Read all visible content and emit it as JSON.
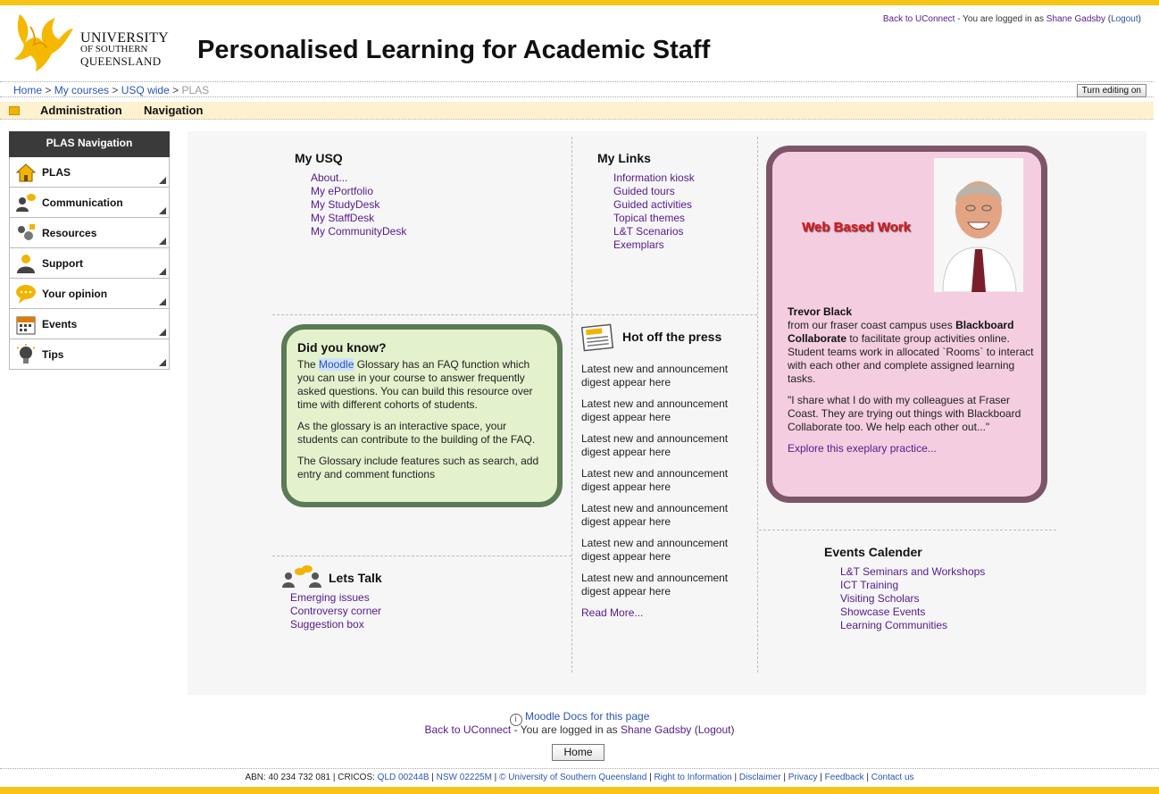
{
  "header": {
    "logo": {
      "line1": "UNIVERSITY",
      "line2": "OF SOUTHERN",
      "line3": "QUEENSLAND"
    },
    "title": "Personalised Learning for Academic Staff",
    "login": {
      "back": "Back to UConnect",
      "mid": " - You are logged in as ",
      "user": "Shane Gadsby",
      "open": " (",
      "logout": "Logout",
      "close": ")"
    }
  },
  "breadcrumb": {
    "home": "Home",
    "sep": " > ",
    "courses": "My courses",
    "usq": "USQ wide",
    "current": "PLAS"
  },
  "edit_button": "Turn editing on",
  "menubar": {
    "admin": "Administration",
    "nav": "Navigation"
  },
  "sidenav": {
    "title": "PLAS Navigation",
    "items": [
      {
        "label": "PLAS",
        "icon": "home-icon"
      },
      {
        "label": "Communication",
        "icon": "communication-icon"
      },
      {
        "label": "Resources",
        "icon": "resources-icon"
      },
      {
        "label": "Support",
        "icon": "support-icon"
      },
      {
        "label": "Your opinion",
        "icon": "speech-bubble-icon"
      },
      {
        "label": "Events",
        "icon": "calendar-icon"
      },
      {
        "label": "Tips",
        "icon": "lightbulb-icon"
      }
    ]
  },
  "my_usq": {
    "title": "My USQ",
    "links": [
      "About...",
      "My ePortfolio",
      "My StudyDesk",
      "My StaffDesk",
      "My CommunityDesk"
    ]
  },
  "my_links": {
    "title": "My Links",
    "links": [
      "Information kiosk",
      "Guided tours",
      "Guided activities",
      "Topical themes",
      "L&T Scenarios",
      "Exemplars"
    ]
  },
  "did_you_know": {
    "title": "Did you know?",
    "p1_pre": "The ",
    "p1_link": "Moodle",
    "p1_post": " Glossary has an FAQ function which you can use in your course to answer frequently asked questions. You can build this resource over time with different cohorts of students.",
    "p2": "As the glossary is an interactive space, your students can contribute to the building of the FAQ.",
    "p3": "The Glossary include features such as search, add entry and comment functions"
  },
  "hot_press": {
    "title": "Hot off the press",
    "items": [
      "Latest new and announcement digest appear here",
      "Latest new and announcement digest appear here",
      "Latest new and announcement digest appear here",
      "Latest new and announcement digest appear here",
      "Latest new and announcement digest appear here",
      "Latest new and announcement digest appear here",
      "Latest new and announcement digest appear here"
    ],
    "read_more": "Read More..."
  },
  "feature": {
    "heading": "Web Based Work",
    "name": "Trevor Black",
    "t1": "from our fraser coast campus uses ",
    "bold": "Blackboard Collaborate",
    "t2": " to facilitate group activities online. Student teams work in allocated `Rooms` to interact with each other and complete assigned learning tasks.",
    "quote": "\"I share what I do with my colleagues at Fraser Coast. They are trying out things with Blackboard Collaborate too. We help each other out...\"",
    "link": "Explore this exeplary practice..."
  },
  "lets_talk": {
    "title": "Lets Talk",
    "links": [
      "Emerging issues",
      "Controversy corner",
      "Suggestion box"
    ]
  },
  "events": {
    "title": "Events Calender",
    "links": [
      "L&T Seminars and Workshops",
      "ICT Training",
      "Visiting Scholars",
      "Showcase Events",
      "Learning Communities"
    ]
  },
  "footer": {
    "docs": "Moodle Docs for this page",
    "home_button": "Home",
    "abn_pre": "ABN: 40 234 732 081 | CRICOS: ",
    "qld": "QLD 00244B",
    "nsw": "NSW 02225M",
    "copy": "© University of Southern Queensland",
    "rti": "Right to Information",
    "disclaimer": "Disclaimer",
    "privacy": "Privacy",
    "feedback": "Feedback",
    "contact": "Contact us"
  },
  "colors": {
    "brand_yellow": "#f5c518",
    "dyk_bg": "#e3f1cc",
    "dyk_border": "#5b7a56",
    "feature_bg": "#f4cde0",
    "feature_border": "#7d5569"
  }
}
